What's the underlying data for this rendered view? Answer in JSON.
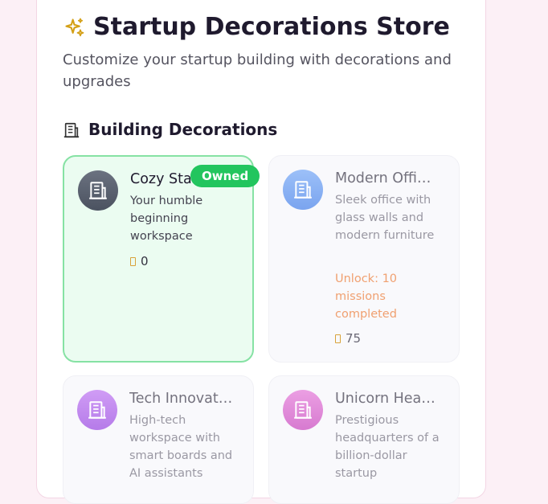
{
  "header": {
    "title": "Startup Decorations Store",
    "subtitle": "Customize your startup building with decorations and upgrades",
    "icon": "sparkles-icon",
    "icon_color": "#d4a017"
  },
  "section": {
    "title": "Building Decorations",
    "icon": "building-icon"
  },
  "cards": [
    {
      "name": "Cozy Startup…",
      "description": "Your humble beginning workspace",
      "price": "0",
      "status": "Owned",
      "avatar_color": "#5b6270"
    },
    {
      "name": "Modern Offi…",
      "description": "Sleek office with glass walls and modern furniture",
      "unlock": "Unlock: 10 missions completed",
      "price": "75",
      "avatar_color": "#8fb3f5"
    },
    {
      "name": "Tech Innovat…",
      "description": "High-tech workspace with smart boards and AI assistants",
      "avatar_color": "#c38cf0"
    },
    {
      "name": "Unicorn Hea…",
      "description": "Prestigious headquarters of a billion-dollar startup",
      "avatar_color": "#e08bd8"
    }
  ]
}
